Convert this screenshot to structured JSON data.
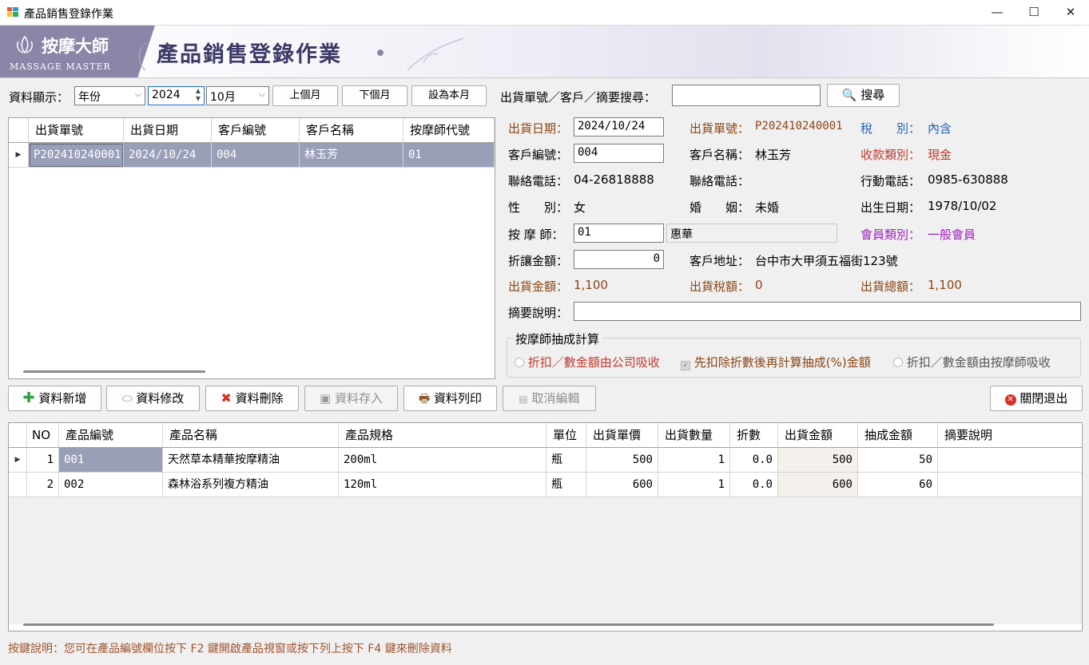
{
  "window": {
    "title": "產品銷售登錄作業",
    "min": "—",
    "max": "☐",
    "close": "✕"
  },
  "banner": {
    "logo_cn": "按摩大師",
    "logo_en": "MASSAGE MASTER",
    "title": "產品銷售登錄作業"
  },
  "filter": {
    "display_label": "資料顯示：",
    "mode": "年份",
    "year": "2024",
    "month": "10月",
    "prev_month": "上個月",
    "next_month": "下個月",
    "this_month": "設為本月",
    "search_label": "出貨單號／客戶／摘要搜尋：",
    "search_value": "",
    "search_button": "搜尋"
  },
  "list": {
    "columns": [
      "出貨單號",
      "出貨日期",
      "客戶編號",
      "客戶名稱",
      "按摩師代號"
    ],
    "rows": [
      [
        "P202410240001",
        "2024/10/24",
        "004",
        "林玉芳",
        "01"
      ]
    ]
  },
  "detail": {
    "ship_date_label": "出貨日期：",
    "ship_date": "2024/10/24",
    "ship_no_label": "出貨單號：",
    "ship_no": "P202410240001",
    "tax_label": "稅　　別：",
    "tax": "內含",
    "cust_no_label": "客戶編號：",
    "cust_no": "004",
    "cust_name_label": "客戶名稱：",
    "cust_name": "林玉芳",
    "pay_label": "收款類別：",
    "pay": "現金",
    "phone_label": "聯絡電話：",
    "phone": "04-26818888",
    "phone2_label": "聯絡電話：",
    "phone2": "",
    "mobile_label": "行動電話：",
    "mobile": "0985-630888",
    "gender_label": "性　　別：",
    "gender": "女",
    "marriage_label": "婚　　姻：",
    "marriage": "未婚",
    "birth_label": "出生日期：",
    "birth": "1978/10/02",
    "therapist_label": "按 摩 師：",
    "therapist_no": "01",
    "therapist_name": "惠華",
    "member_label": "會員類別：",
    "member": "一般會員",
    "discount_label": "折讓金額：",
    "discount": "0",
    "address_label": "客戶地址：",
    "address": "台中市大甲須五福街123號",
    "amount_label": "出貨金額：",
    "amount": "1,100",
    "taxamt_label": "出貨稅額：",
    "taxamt": "0",
    "total_label": "出貨總額：",
    "total": "1,100",
    "memo_label": "摘要說明：",
    "memo": ""
  },
  "commission": {
    "title": "按摩師抽成計算",
    "opt1": "折扣／數金額由公司吸收",
    "opt2": "先扣除折數後再計算抽成(%)金額",
    "opt3": "折扣／數金額由按摩師吸收"
  },
  "actions": {
    "add": "資料新增",
    "edit": "資料修改",
    "delete": "資料刪除",
    "save": "資料存入",
    "print": "資料列印",
    "cancel": "取消編輯",
    "exit": "關閉退出"
  },
  "items": {
    "columns": [
      "NO",
      "產品編號",
      "產品名稱",
      "產品規格",
      "單位",
      "出貨單價",
      "出貨數量",
      "折數",
      "出貨金額",
      "抽成金額",
      "摘要說明"
    ],
    "rows": [
      [
        "1",
        "001",
        "天然草本精華按摩精油",
        "200ml",
        "瓶",
        "500",
        "1",
        "0.0",
        "500",
        "50",
        ""
      ],
      [
        "2",
        "002",
        "森林浴系列複方精油",
        "120ml",
        "瓶",
        "600",
        "1",
        "0.0",
        "600",
        "60",
        ""
      ]
    ]
  },
  "hint": "按鍵說明：您可在產品編號欄位按下 F2 鍵開啟產品視窗或按下列上按下 F4 鍵來刪除資料",
  "colors": {
    "accent": "#8a86a8",
    "brown": "#8b4513",
    "blue": "#1f5fbf",
    "red": "#c0392b",
    "purple": "#a020c0",
    "selected": "#9a9fb8"
  }
}
